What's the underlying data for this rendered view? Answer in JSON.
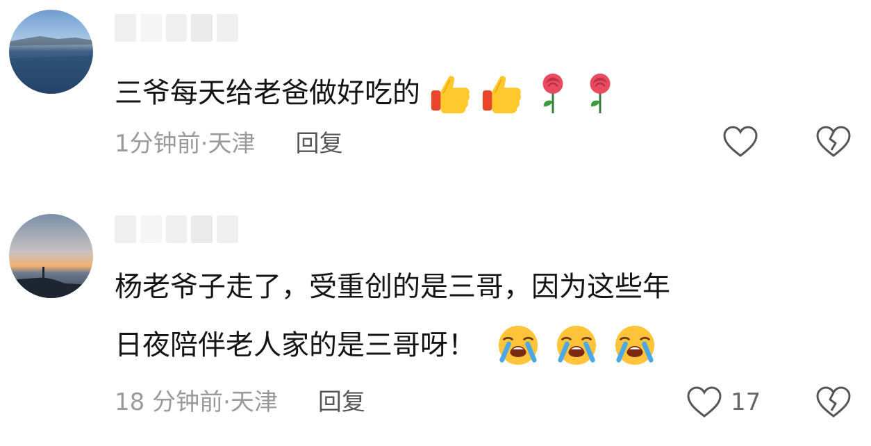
{
  "comments": [
    {
      "text": "三爷每天给老爸做好吃的",
      "emojis": [
        "thumbs-up",
        "thumbs-up",
        "rose",
        "rose"
      ],
      "time": "1分钟前",
      "location": "天津",
      "reply_label": "回复",
      "likes": ""
    },
    {
      "line1": "杨老爷子走了，受重创的是三哥，因为这些年",
      "line2": "日夜陪伴老人家的是三哥呀！",
      "emojis": [
        "crying-face",
        "crying-face",
        "crying-face"
      ],
      "time": "18 分钟前",
      "location": "天津",
      "reply_label": "回复",
      "likes": "17"
    }
  ],
  "separator": " · ",
  "colors": {
    "text": "#141414",
    "meta": "#9a9a9a",
    "reply": "#555555",
    "icon": "#555555"
  }
}
